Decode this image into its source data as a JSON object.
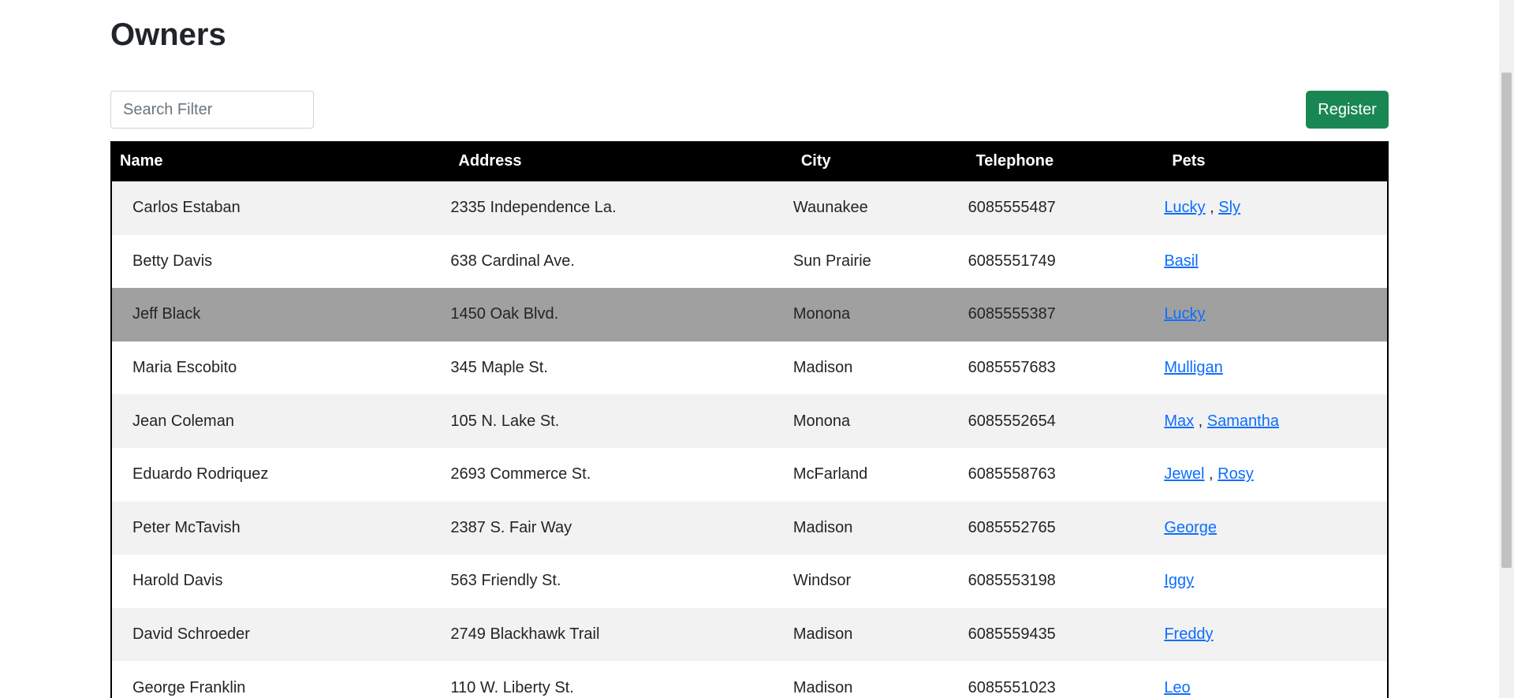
{
  "header": {
    "title": "Owners"
  },
  "search": {
    "placeholder": "Search Filter"
  },
  "actions": {
    "register_label": "Register"
  },
  "table": {
    "columns": [
      "Name",
      "Address",
      "City",
      "Telephone",
      "Pets"
    ],
    "rows": [
      {
        "name": "Carlos Estaban",
        "address": "2335 Independence La.",
        "city": "Waunakee",
        "telephone": "6085555487",
        "pets": [
          "Lucky",
          "Sly"
        ]
      },
      {
        "name": "Betty Davis",
        "address": "638 Cardinal Ave.",
        "city": "Sun Prairie",
        "telephone": "6085551749",
        "pets": [
          "Basil"
        ]
      },
      {
        "name": "Jeff Black",
        "address": "1450 Oak Blvd.",
        "city": "Monona",
        "telephone": "6085555387",
        "pets": [
          "Lucky"
        ]
      },
      {
        "name": "Maria Escobito",
        "address": "345 Maple St.",
        "city": "Madison",
        "telephone": "6085557683",
        "pets": [
          "Mulligan"
        ]
      },
      {
        "name": "Jean Coleman",
        "address": "105 N. Lake St.",
        "city": "Monona",
        "telephone": "6085552654",
        "pets": [
          "Max",
          "Samantha"
        ]
      },
      {
        "name": "Eduardo Rodriquez",
        "address": "2693 Commerce St.",
        "city": "McFarland",
        "telephone": "6085558763",
        "pets": [
          "Jewel",
          "Rosy"
        ]
      },
      {
        "name": "Peter McTavish",
        "address": "2387 S. Fair Way",
        "city": "Madison",
        "telephone": "6085552765",
        "pets": [
          "George"
        ]
      },
      {
        "name": "Harold Davis",
        "address": "563 Friendly St.",
        "city": "Windsor",
        "telephone": "6085553198",
        "pets": [
          "Iggy"
        ]
      },
      {
        "name": "David Schroeder",
        "address": "2749 Blackhawk Trail",
        "city": "Madison",
        "telephone": "6085559435",
        "pets": [
          "Freddy"
        ]
      },
      {
        "name": "George Franklin",
        "address": "110 W. Liberty St.",
        "city": "Madison",
        "telephone": "6085551023",
        "pets": [
          "Leo"
        ]
      }
    ],
    "hovered_row_index": 2
  },
  "colors": {
    "register_button": "#198754",
    "header_background": "#000000",
    "row_striped": "#f2f2f2",
    "row_hover": "#a0a0a0",
    "link": "#0d6efd"
  }
}
